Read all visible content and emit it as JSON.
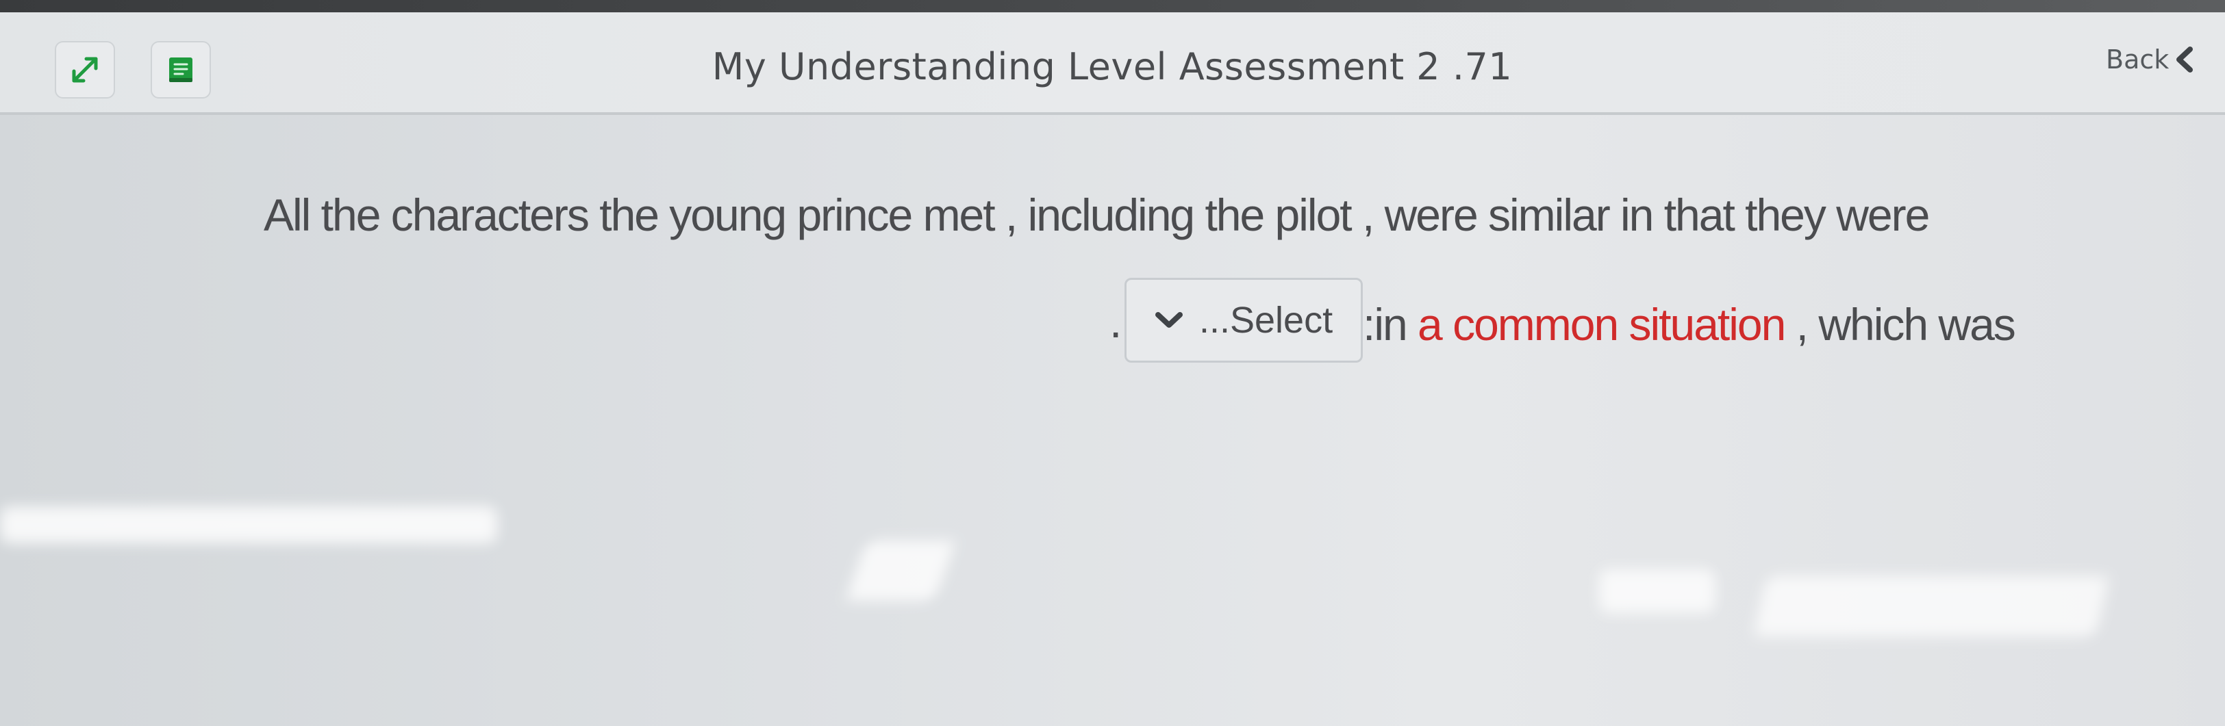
{
  "header": {
    "title": "My Understanding Level Assessment 2 .71",
    "back_label": "Back",
    "icons": {
      "expand": "expand-arrows-icon",
      "dictionary": "dictionary-book-icon",
      "back": "chevron-left-icon"
    }
  },
  "question": {
    "line_one": "All the characters the young prince met , including the pilot , were similar in that they were",
    "period": ".",
    "select": {
      "selected_value": "...Select"
    },
    "after_select_prefix": ":in ",
    "highlighted_phrase": "a common situation",
    "after_select_suffix": " , which was"
  },
  "colors": {
    "accent_red": "#d02b2b",
    "dictionary_green": "#1e9a3d"
  }
}
